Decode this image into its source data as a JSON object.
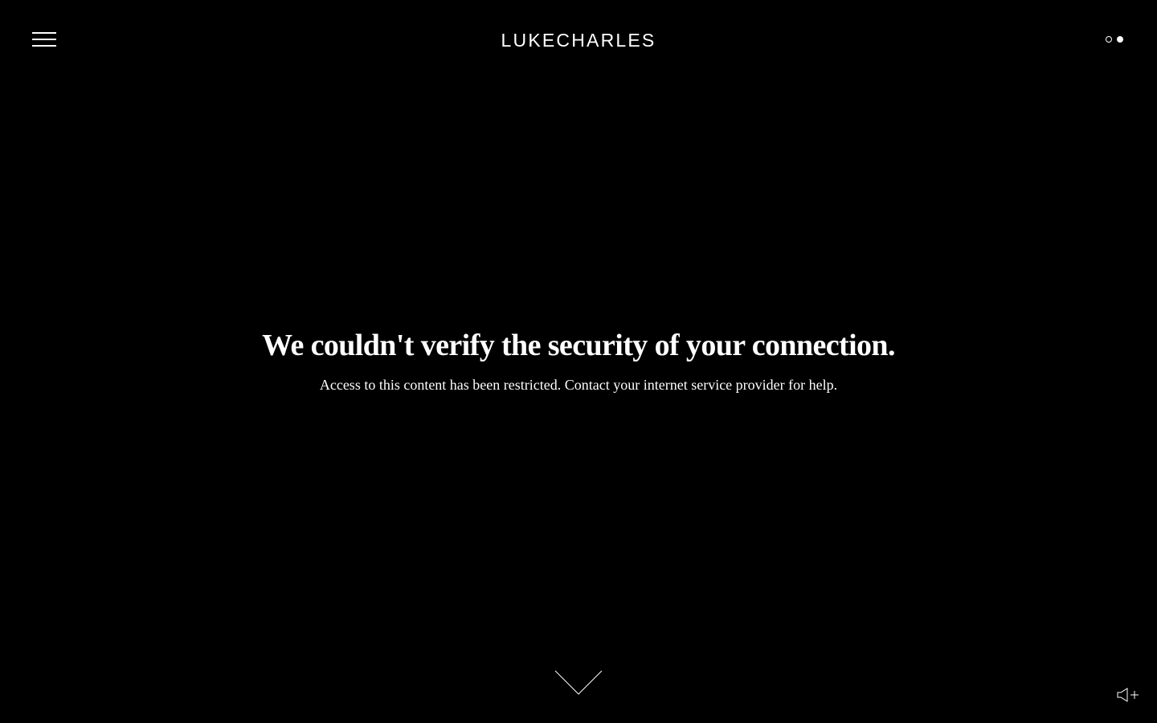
{
  "header": {
    "logo_text": "LUKECHARLES",
    "menu_icon": "hamburger-menu-icon",
    "theme_toggle_icon": "light-dark-toggle-icon"
  },
  "main": {
    "heading": "We couldn't verify the security of your connection.",
    "message": "Access to this content has been restricted. Contact your internet service provider for help."
  },
  "footer": {
    "scroll_icon": "chevron-down-icon",
    "sound_icon": "speaker-plus-icon"
  },
  "colors": {
    "background": "#000000",
    "foreground": "#ffffff"
  }
}
